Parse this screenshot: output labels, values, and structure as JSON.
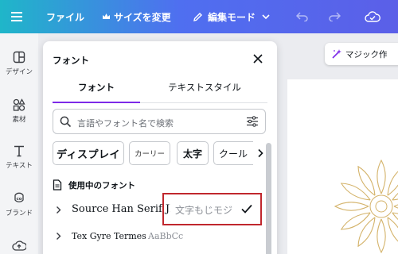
{
  "topbar": {
    "menu_icon": "hamburger-icon",
    "file_label": "ファイル",
    "resize_label": "サイズを変更",
    "resize_icon": "crown-icon",
    "edit_mode_label": "編集モード",
    "edit_mode_icon": "pencil-icon",
    "undo_icon": "undo-icon",
    "redo_icon": "redo-icon",
    "save_status_icon": "cloud-check-icon"
  },
  "rail": {
    "items": [
      {
        "label": "デザイン",
        "icon": "layout-icon"
      },
      {
        "label": "素材",
        "icon": "shapes-icon"
      },
      {
        "label": "テキスト",
        "icon": "text-icon"
      },
      {
        "label": "ブランド",
        "icon": "brand-icon"
      },
      {
        "label": "",
        "icon": "upload-cloud-icon"
      }
    ]
  },
  "canvas": {
    "magic_button_label": "マジック作",
    "magic_icon": "magic-wand-icon"
  },
  "font_panel": {
    "title": "フォント",
    "tabs": [
      {
        "label": "フォント",
        "active": true
      },
      {
        "label": "テキストスタイル",
        "active": false
      }
    ],
    "search_placeholder": "言語やフォント名で検索",
    "filters": [
      {
        "label": "ディスプレイ"
      },
      {
        "label": "カーリー"
      },
      {
        "label": "太字"
      },
      {
        "label": "クール"
      }
    ],
    "section_title": "使用中のフォント",
    "fonts": [
      {
        "name": "Source Han Serif JP",
        "sample": "文字もじモジ",
        "selected": true
      },
      {
        "name": "Tex Gyre Termes",
        "sample": "AaBbCc",
        "selected": false
      }
    ]
  },
  "colors": {
    "accent_purple": "#7d2ae8",
    "highlight_red": "#c0272d",
    "topbar_start": "#1fb6c9",
    "topbar_end": "#5b5fe8",
    "ornament_gold": "#d4b36a"
  }
}
